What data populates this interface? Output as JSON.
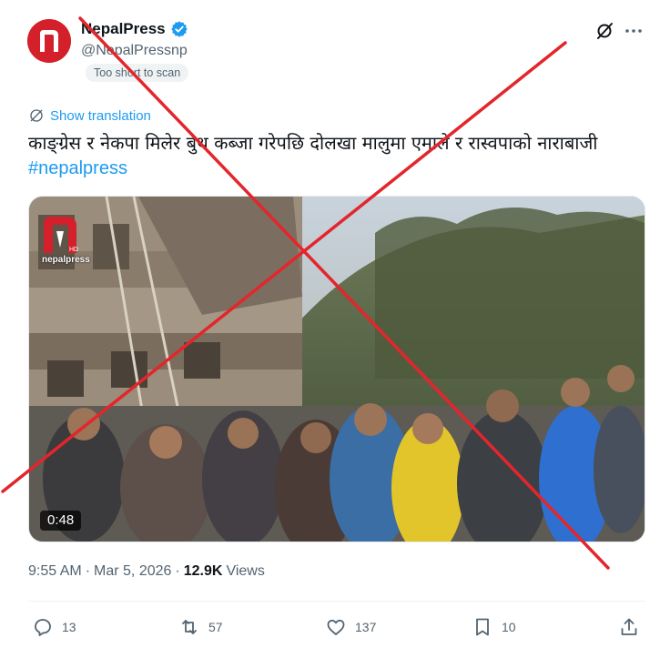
{
  "author": {
    "display_name": "NepalPress",
    "handle": "@NepalPressnp",
    "scan_badge": "Too short to scan",
    "avatar_logo": "nepal press"
  },
  "translate_label": "Show translation",
  "tweet": {
    "text": "काङ्ग्रेस र नेकपा मिलेर बुथ कब्जा गरेपछि दोलखा मालुमा एमाले र रास्वपाको नाराबाजी",
    "hashtag": "#nepalpress"
  },
  "media": {
    "duration": "0:48",
    "watermark": "nepalpress",
    "watermark_badge": "HD"
  },
  "meta": {
    "time": "9:55 AM",
    "separator": "·",
    "date": "Mar 5, 2026",
    "views_count": "12.9K",
    "views_label": "Views"
  },
  "actions": {
    "replies": "13",
    "reposts": "57",
    "likes": "137",
    "bookmarks": "10"
  },
  "colors": {
    "accent": "#1d9bf0",
    "brand_red": "#d4202a",
    "cross_red": "#e3262c",
    "muted": "#536471"
  },
  "icons": {
    "verified": "verified-badge-icon",
    "grok": "grok-icon",
    "more": "more-icon",
    "translate": "translate-icon",
    "reply": "reply-icon",
    "repost": "repost-icon",
    "like": "like-icon",
    "bookmark": "bookmark-icon",
    "share": "share-icon"
  }
}
